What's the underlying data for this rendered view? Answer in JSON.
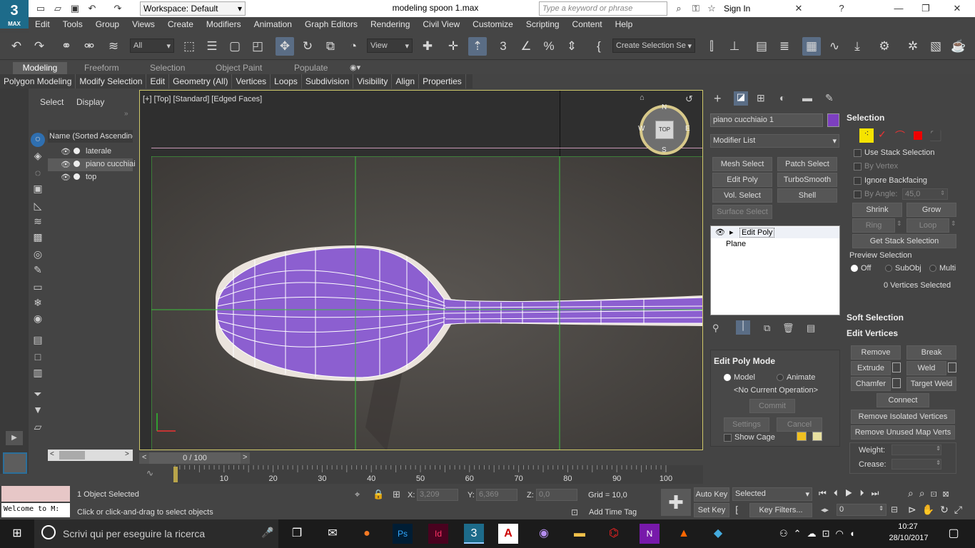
{
  "title_bar": {
    "workspace": "Workspace: Default",
    "document_title": "modeling spoon 1.max",
    "search_placeholder": "Type a keyword or phrase",
    "sign_in": "Sign In"
  },
  "logo": {
    "big": "3",
    "small": "MAX"
  },
  "menu": [
    "Edit",
    "Tools",
    "Group",
    "Views",
    "Create",
    "Modifiers",
    "Animation",
    "Graph Editors",
    "Rendering",
    "Civil View",
    "Customize",
    "Scripting",
    "Content",
    "Help"
  ],
  "toolbar": {
    "filter": "All",
    "ref_coord": "View",
    "selection_set": "Create Selection Se"
  },
  "ribbon_tabs": [
    "Modeling",
    "Freeform",
    "Selection",
    "Object Paint",
    "Populate"
  ],
  "ribbon_items": [
    "Polygon Modeling",
    "Modify Selection",
    "Edit",
    "Geometry (All)",
    "Vertices",
    "Loops",
    "Subdivision",
    "Visibility",
    "Align",
    "Properties"
  ],
  "scene": {
    "tab_select": "Select",
    "tab_display": "Display",
    "header": "Name (Sorted Ascending",
    "objects": [
      "laterale",
      "piano cucchiai",
      "top"
    ]
  },
  "viewport": {
    "label": "[+] [Top] [Standard] [Edged Faces]",
    "compass_n": "N",
    "compass_s": "S",
    "compass_w": "W",
    "compass_e": "E",
    "cube": "TOP"
  },
  "command_panel": {
    "object_name": "piano cucchiaio 1",
    "object_color": "#7d3fc0",
    "modifier_list": "Modifier List",
    "buttons": [
      "Mesh Select",
      "Patch Select",
      "Edit Poly",
      "TurboSmooth",
      "Vol. Select",
      "Shell",
      "Surface Select"
    ],
    "stack": [
      "Edit Poly",
      "Plane"
    ],
    "edit_poly_mode": {
      "header": "Edit Poly Mode",
      "model": "Model",
      "animate": "Animate",
      "operation": "<No Current Operation>",
      "commit": "Commit",
      "settings": "Settings",
      "cancel": "Cancel",
      "show_cage": "Show Cage"
    }
  },
  "selection_panel": {
    "header": "Selection",
    "use_stack": "Use Stack Selection",
    "by_vertex": "By Vertex",
    "ignore_backfacing": "Ignore Backfacing",
    "by_angle": "By Angle:",
    "angle_value": "45,0",
    "shrink": "Shrink",
    "grow": "Grow",
    "ring": "Ring",
    "loop": "Loop",
    "get_stack": "Get Stack Selection",
    "preview": "Preview Selection",
    "off": "Off",
    "subobj": "SubObj",
    "multi": "Multi",
    "count": "0 Vertices Selected",
    "soft": "Soft Selection",
    "edit_vertices": "Edit Vertices",
    "remove": "Remove",
    "break": "Break",
    "extrude": "Extrude",
    "weld": "Weld",
    "chamfer": "Chamfer",
    "target_weld": "Target Weld",
    "connect": "Connect",
    "remove_isolated": "Remove Isolated Vertices",
    "remove_unused": "Remove Unused Map Verts",
    "weight": "Weight:",
    "crease": "Crease:"
  },
  "timeline": {
    "counter": "0 / 100",
    "ticks": [
      "0",
      "10",
      "20",
      "30",
      "40",
      "50",
      "60",
      "70",
      "80",
      "90",
      "100"
    ]
  },
  "status": {
    "maxscript": "Welcome to M:",
    "selected": "1 Object Selected",
    "prompt": "Click or click-and-drag to select objects",
    "x_label": "X:",
    "x": "3,209",
    "y_label": "Y:",
    "y": "6,369",
    "z_label": "Z:",
    "z": "0,0",
    "grid": "Grid = 10,0",
    "add_time_tag": "Add Time Tag",
    "auto_key": "Auto Key",
    "set_key": "Set Key",
    "selected_dropdown": "Selected",
    "key_filters": "Key Filters...",
    "frame": "0"
  },
  "taskbar": {
    "search": "Scrivi qui per eseguire la ricerca",
    "time": "10:27",
    "date": "28/10/2017"
  }
}
